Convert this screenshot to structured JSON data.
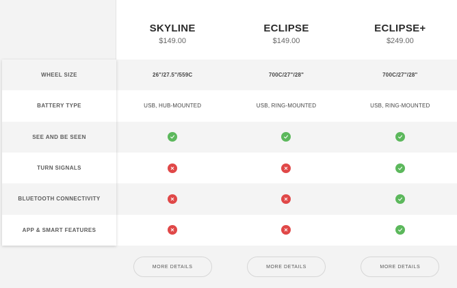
{
  "products": [
    {
      "name": "SKYLINE",
      "price": "$149.00",
      "details_label": "MORE DETAILS"
    },
    {
      "name": "ECLIPSE",
      "price": "$149.00",
      "details_label": "MORE DETAILS"
    },
    {
      "name": "ECLIPSE+",
      "price": "$249.00",
      "details_label": "MORE DETAILS"
    }
  ],
  "features": [
    {
      "label": "WHEEL SIZE",
      "type": "text",
      "values": [
        "26\"/27.5\"/559C",
        "700C/27\"/28\"",
        "700C/27\"/28\""
      ]
    },
    {
      "label": "BATTERY TYPE",
      "type": "text",
      "values": [
        "USB, HUB-MOUNTED",
        "USB, RING-MOUNTED",
        "USB, RING-MOUNTED"
      ]
    },
    {
      "label": "SEE AND BE SEEN",
      "type": "check",
      "values": [
        true,
        true,
        true
      ]
    },
    {
      "label": "TURN SIGNALS",
      "type": "check",
      "values": [
        false,
        false,
        true
      ]
    },
    {
      "label": "BLUETOOTH CONNECTIVITY",
      "type": "check",
      "values": [
        false,
        false,
        true
      ]
    },
    {
      "label": "APP & SMART FEATURES",
      "type": "check",
      "values": [
        false,
        false,
        true
      ]
    }
  ],
  "icons": {
    "yes": "check-icon",
    "no": "cross-icon"
  },
  "colors": {
    "yes": "#5cb85c",
    "no": "#e04848",
    "shaded_row": "#f4f4f4"
  }
}
